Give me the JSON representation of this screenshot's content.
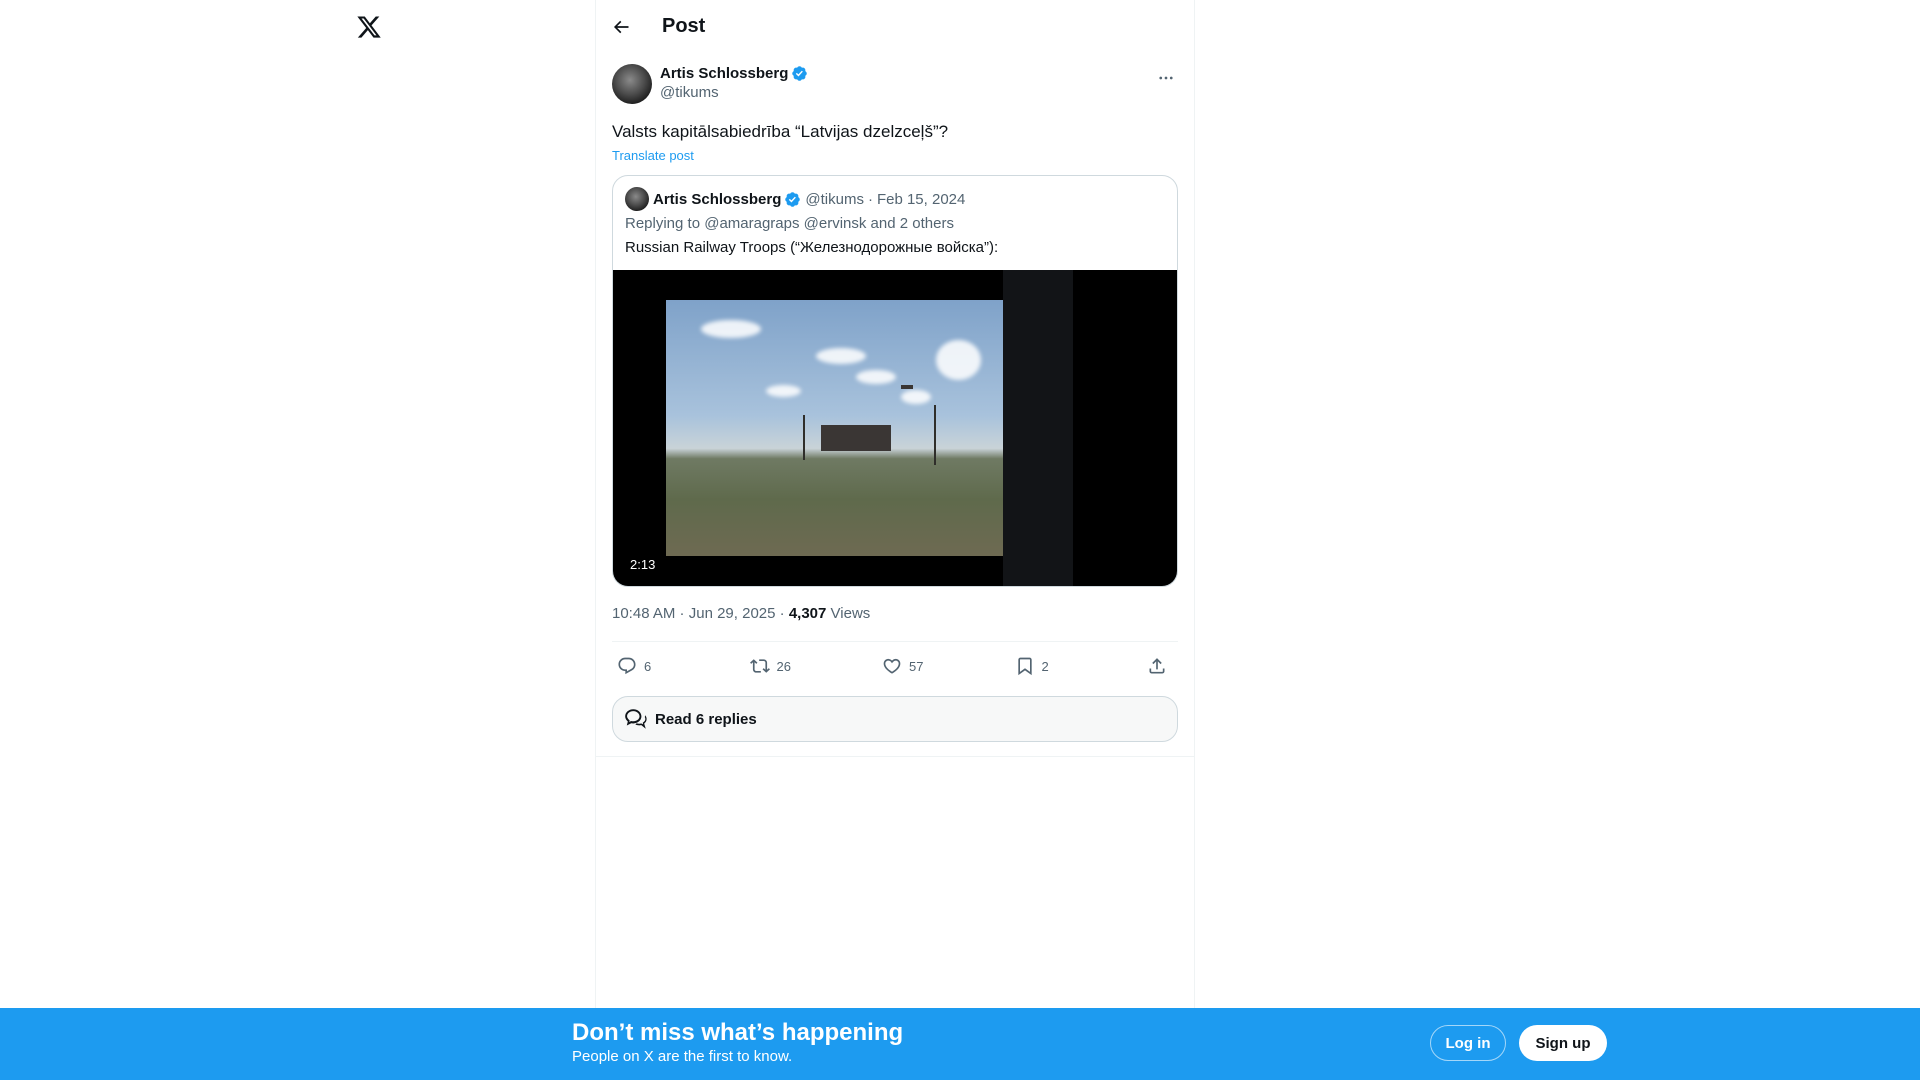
{
  "app": {
    "logo": "x-logo-icon"
  },
  "header": {
    "title": "Post",
    "back_icon": "arrow-left-icon"
  },
  "post": {
    "author_name": "Artis Schlossberg",
    "author_handle": "@tikums",
    "text": "Valsts kapitālsabiedrība “Latvijas dzelzceļš”?",
    "translate_label": "Translate post",
    "quote": {
      "author_name": "Artis Schlossberg",
      "author_handle": "@tikums",
      "separator": "·",
      "date": "Feb 15, 2024",
      "replying_prefix": "Replying to ",
      "replying_to": "@amaragraps @ervinsk and 2 others",
      "text": "Russian Railway Troops (“Железнодорожные войска”):",
      "video_duration": "2:13"
    },
    "time": "10:48 AM",
    "date": "Jun 29, 2025",
    "views_count": "4,307",
    "views_label": "Views",
    "actions": {
      "replies": "6",
      "reposts": "26",
      "likes": "57",
      "bookmarks": "2"
    },
    "read_replies_label": "Read 6 replies"
  },
  "banner": {
    "title": "Don’t miss what’s happening",
    "subtitle": "People on X are the first to know.",
    "login_label": "Log in",
    "signup_label": "Sign up"
  },
  "colors": {
    "accent": "#1d9bf0",
    "text": "#0f1419",
    "muted": "#536471",
    "border": "#cfd9de"
  }
}
